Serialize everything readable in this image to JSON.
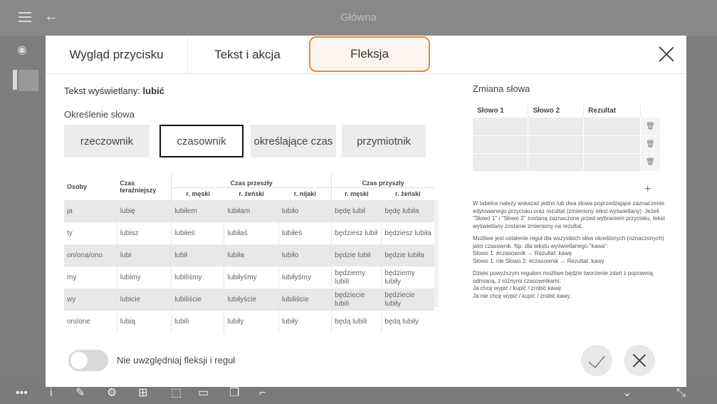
{
  "app": {
    "title": "Główna"
  },
  "dialog": {
    "tabs": [
      {
        "label": "Wygląd przycisku"
      },
      {
        "label": "Tekst i akcja"
      },
      {
        "label": "Fleksja"
      }
    ],
    "active_tab": "Fleksja",
    "display_text_label": "Tekst wyświetlany:",
    "display_text_value": "lubić",
    "word_type_label": "Określenie słowa",
    "word_types": [
      {
        "label": "rzeczownik"
      },
      {
        "label": "czasownik"
      },
      {
        "label": "określające czas"
      },
      {
        "label": "przymiotnik"
      }
    ],
    "selected_word_type": "czasownik",
    "flexion": {
      "header": {
        "persons": "Osoby",
        "present": "Czas teraźniejszy",
        "past": "Czas przeszły",
        "future": "Czas przyszły",
        "masc": "r. męski",
        "fem": "r. żeński",
        "neut": "r. nijaki"
      },
      "rows": [
        {
          "person": "ja",
          "present": "lubię",
          "past_m": "lubiłem",
          "past_f": "lubiłam",
          "past_n": "lubiło",
          "fut_m": "będę lubił",
          "fut_f": "będę lubiła"
        },
        {
          "person": "ty",
          "present": "lubisz",
          "past_m": "lubiłeś",
          "past_f": "lubiłaś",
          "past_n": "lubiłeś",
          "fut_m": "będziesz lubił",
          "fut_f": "będziesz lubiła"
        },
        {
          "person": "on/ona/ono",
          "present": "lubi",
          "past_m": "lubił",
          "past_f": "lubiła",
          "past_n": "lubiło",
          "fut_m": "będzie lubił",
          "fut_f": "będzie lubiła"
        },
        {
          "person": "my",
          "present": "lubimy",
          "past_m": "lubiliśmy",
          "past_f": "lubiłyśmy",
          "past_n": "lubiłyśmy",
          "fut_m": "będziemy lubili",
          "fut_f": "będziemy lubiły"
        },
        {
          "person": "wy",
          "present": "lubicie",
          "past_m": "lubiliście",
          "past_f": "lubiłyście",
          "past_n": "lubiliście",
          "fut_m": "będziecie lubili",
          "fut_f": "będziecie lubiły"
        },
        {
          "person": "oni/one",
          "present": "lubią",
          "past_m": "lubili",
          "past_f": "lubiły",
          "past_n": "lubiły",
          "fut_m": "będą lubili",
          "fut_f": "będą lubiły"
        }
      ]
    },
    "toggle_label": "Nie uwzględniaj fleksji i reguł",
    "word_change": {
      "title": "Zmiana słowa",
      "columns": [
        "Słowo 1",
        "Słowo 2",
        "Rezultat"
      ],
      "row_count": 3,
      "help": [
        "W tabelce należy wskazać jedno lub dwa słowa poprzedzające zaznaczenie edytowanego przycisku oraz rezultat (zmieniony tekst wyświetlany). Jeżeli \"Słowo 1\" i \"Słowo 2\" zostaną zaznaczone przed wybraniem przycisku, tekst wyświetlany zostanie zmieniony na rezultat.",
        "Możliwe jest ustalenie reguł dla wszystkich słów określonych (oznaczonych) jako czasownik. Np. dla tekstu wyświetlanego \"kawa\":",
        "Słowo 1: #czasownik → Rezultat: kawę",
        "Słowo 1: nie   Słowo 2: #czasownik → Rezultat: kawy",
        "Dzięki powyższym regułom możliwe będzie tworzenie zdań z poprawną odmianą, z różnymi czasownikami:",
        "Ja chcę wypić / kupić / zrobić kawę.",
        "Ja nie chcę wypić / kupić / zrobić kawy."
      ]
    }
  },
  "colors": {
    "accent": "#e58a3a"
  }
}
